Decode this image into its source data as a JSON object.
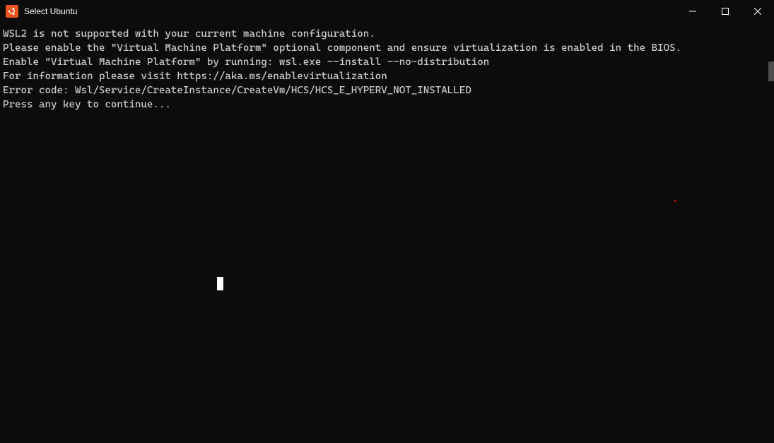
{
  "window": {
    "title": "Select Ubuntu",
    "icon": "ubuntu-icon"
  },
  "controls": {
    "minimize": "minimize-icon",
    "maximize": "maximize-icon",
    "close": "close-icon"
  },
  "terminal": {
    "lines": [
      "WSL2 is not supported with your current machine configuration.",
      "Please enable the \"Virtual Machine Platform\" optional component and ensure virtualization is enabled in the BIOS.",
      "Enable \"Virtual Machine Platform\" by running: wsl.exe --install --no-distribution",
      "For information please visit https://aka.ms/enablevirtualization",
      "Error code: Wsl/Service/CreateInstance/CreateVm/HCS/HCS_E_HYPERV_NOT_INSTALLED",
      "Press any key to continue..."
    ]
  }
}
